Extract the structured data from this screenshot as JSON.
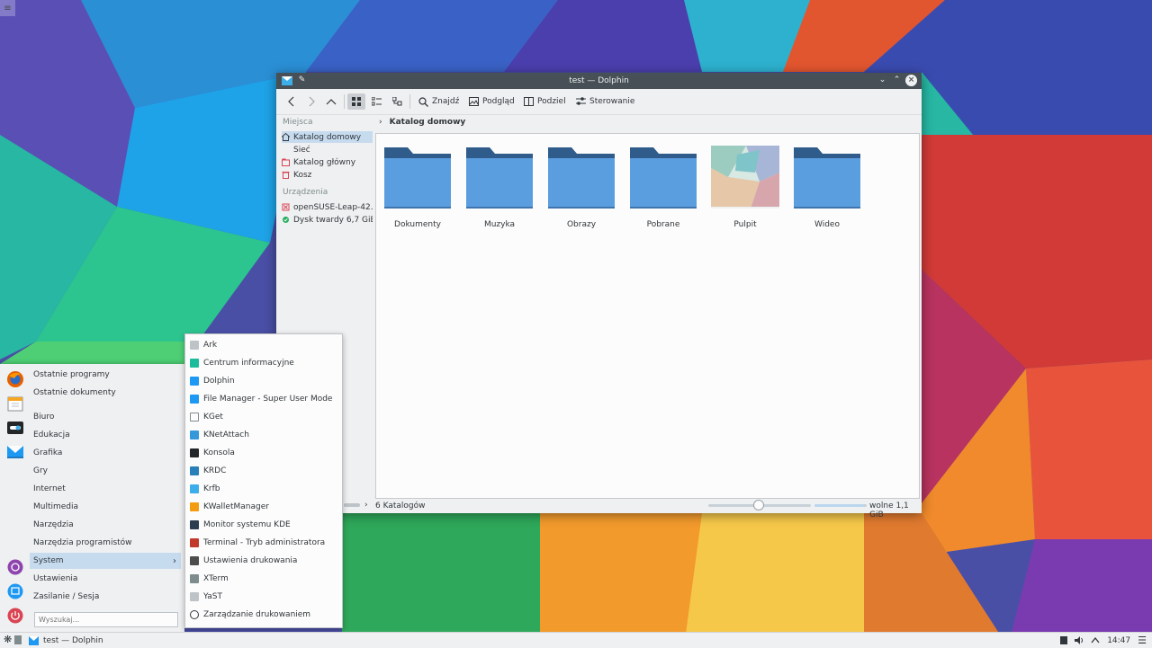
{
  "colors": {
    "accent": "#3daee9",
    "selection": "#c7dbef",
    "titlebar": "#475057",
    "folder": "#5b9ee0"
  },
  "window": {
    "title": "test — Dolphin",
    "toolbar": {
      "find": "Znajdź",
      "preview": "Podgląd",
      "split": "Podziel",
      "control": "Sterowanie"
    },
    "places": {
      "head_places": "Miejsca",
      "items": [
        "Katalog domowy",
        "Sieć",
        "Katalog główny",
        "Kosz"
      ],
      "head_devices": "Urządzenia",
      "devices": [
        "openSUSE-Leap-42.1",
        "Dysk twardy 6,7 GiB"
      ]
    },
    "breadcrumb": "Katalog domowy",
    "files": [
      "Dokumenty",
      "Muzyka",
      "Obrazy",
      "Pobrane",
      "Pulpit",
      "Wideo"
    ],
    "status": {
      "count": "6 Katalogów",
      "free": "wolne 1,1 GiB"
    }
  },
  "menu": {
    "items": [
      "Ostatnie programy",
      "Ostatnie dokumenty",
      "Biuro",
      "Edukacja",
      "Grafika",
      "Gry",
      "Internet",
      "Multimedia",
      "Narzędzia",
      "Narzędzia programistów",
      "System",
      "Ustawienia",
      "Zasilanie / Sesja"
    ],
    "search_placeholder": "Wyszukaj..."
  },
  "submenu": {
    "items": [
      "Ark",
      "Centrum informacyjne",
      "Dolphin",
      "File Manager - Super User Mode",
      "KGet",
      "KNetAttach",
      "Konsola",
      "KRDC",
      "Krfb",
      "KWalletManager",
      "Monitor systemu KDE",
      "Terminal - Tryb administratora",
      "Ustawienia drukowania",
      "XTerm",
      "YaST",
      "Zarządzanie drukowaniem"
    ]
  },
  "taskbar": {
    "task": "test — Dolphin",
    "clock": "14:47"
  }
}
